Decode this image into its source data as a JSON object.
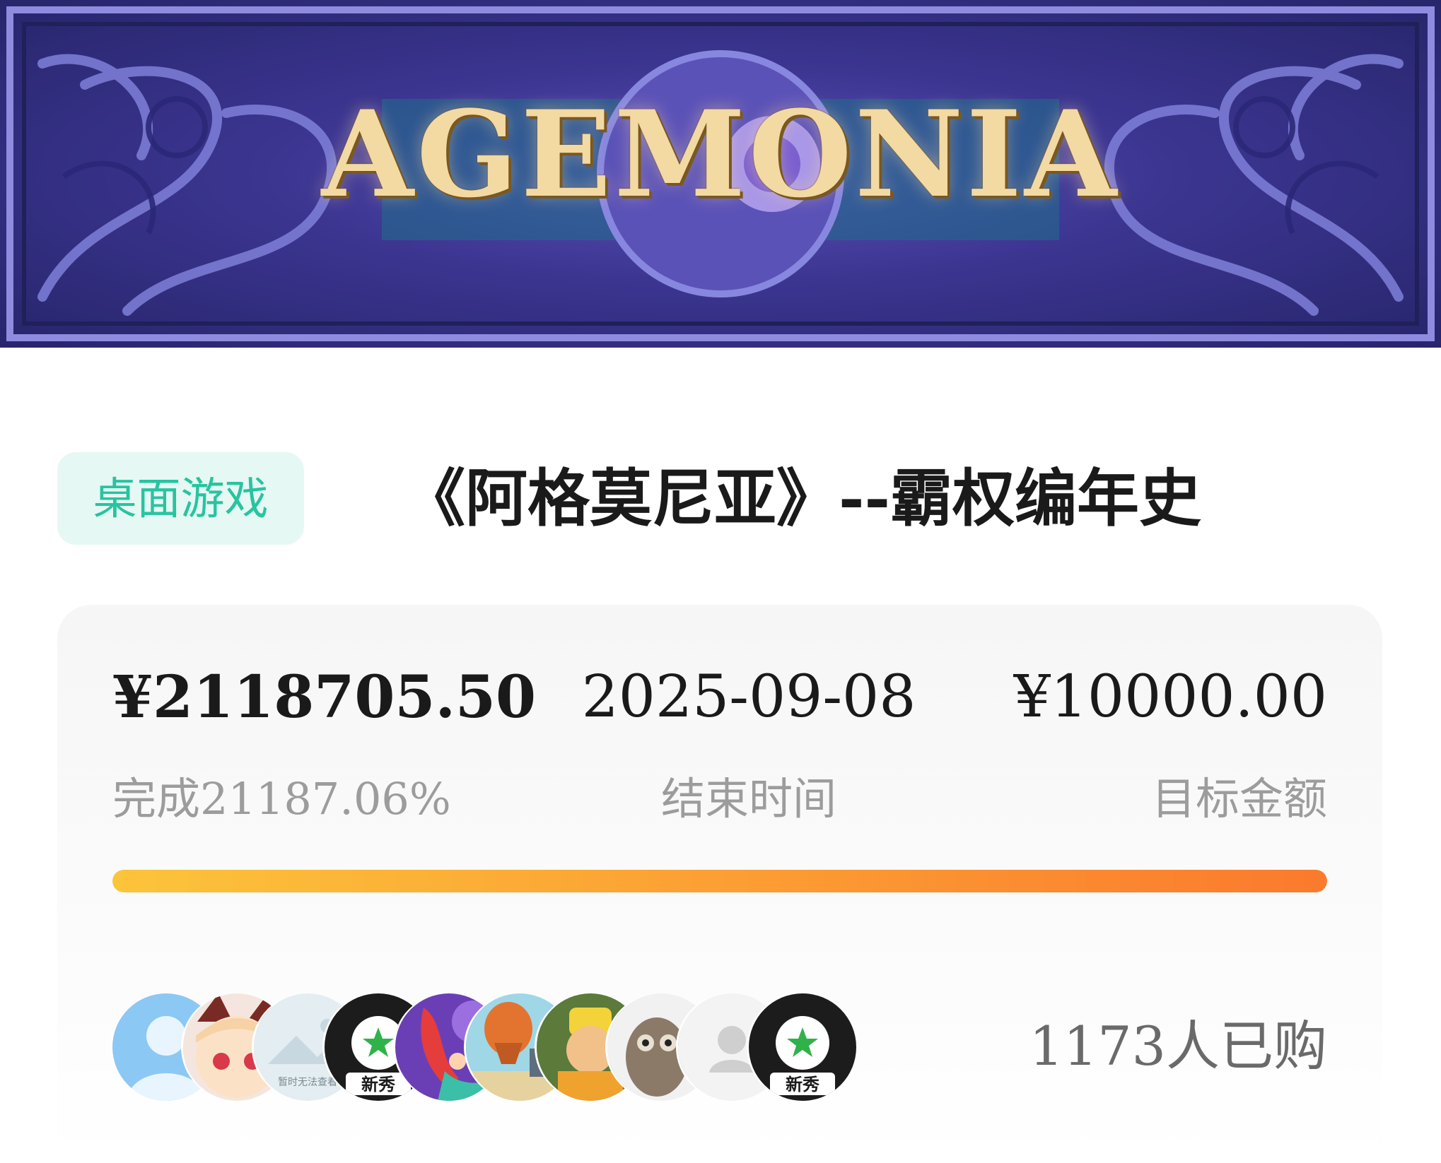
{
  "banner": {
    "logo_text": "AGEMONIA"
  },
  "header": {
    "category": "桌面游戏",
    "title": "《阿格莫尼亚》--霸权编年史"
  },
  "stats": {
    "raised": "¥2118705.50",
    "progress_label": "完成21187.06%",
    "end_date": "2025-09-08",
    "end_date_label": "结束时间",
    "goal": "¥10000.00",
    "goal_label": "目标金额"
  },
  "progress": {
    "percent": 21187.06,
    "bar_fill_fraction": 1.0,
    "colors": [
      "#fcc43a",
      "#fb7a2d"
    ]
  },
  "buyers": {
    "count_text": "1173人已购",
    "avatars": [
      {
        "kind": "default-person"
      },
      {
        "kind": "anime-girl"
      },
      {
        "kind": "image-unavailable",
        "text": "暂时无法查看"
      },
      {
        "kind": "xinxiu-logo",
        "text": "新秀"
      },
      {
        "kind": "mermaid-illustration"
      },
      {
        "kind": "balloon-illustration"
      },
      {
        "kind": "teletubby-photo"
      },
      {
        "kind": "owl-photo"
      },
      {
        "kind": "gray-person"
      },
      {
        "kind": "xinxiu-logo",
        "text": "新秀"
      }
    ]
  },
  "colors": {
    "tag_bg": "#e6f8f3",
    "tag_text": "#27c4a0",
    "label_gray": "#9c9c9c",
    "banner_purple": "#3b3590"
  }
}
